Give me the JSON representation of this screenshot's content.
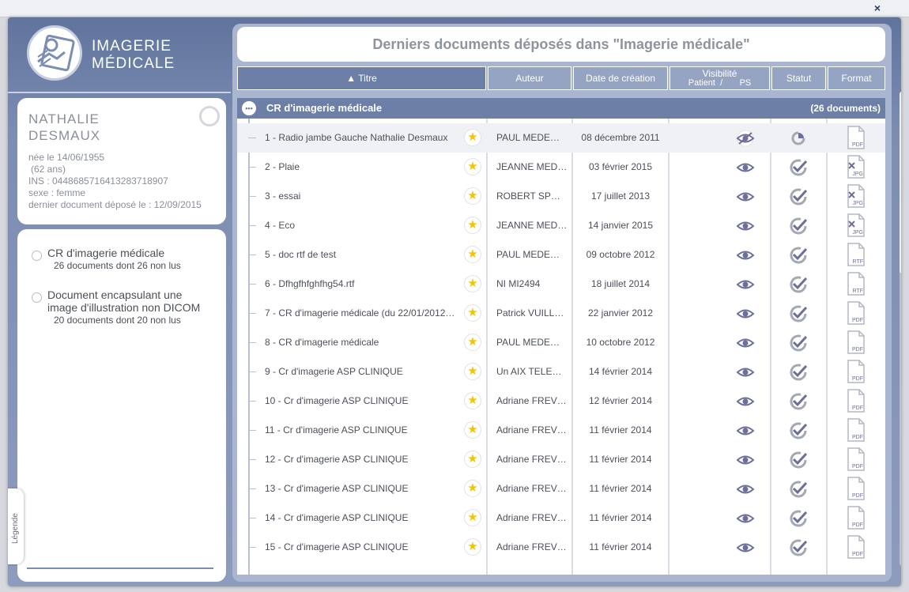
{
  "window": {
    "close_label": "×"
  },
  "logo": {
    "line1": "IMAGERIE",
    "line2": "MÉDICALE"
  },
  "patient": {
    "first_name": "NATHALIE",
    "last_name": "DESMAUX",
    "birth": "née le 14/06/1955",
    "age": "(62 ans)",
    "ins": "INS : 0448685716413283718907",
    "sex": "sexe : femme",
    "last_doc": "dernier document déposé le : 12/09/2015"
  },
  "categories": [
    {
      "label": "CR d'imagerie médicale",
      "sub": "26 documents dont 26 non lus"
    },
    {
      "label": "Document encapsulant une image d'illustration non DICOM",
      "sub": "20 documents dont 20 non lus"
    }
  ],
  "legend_label": "Légende",
  "main": {
    "title": "Derniers documents déposés dans \"Imagerie médicale\"",
    "columns": {
      "title": "▲ Titre",
      "author": "Auteur",
      "date": "Date de création",
      "visibility": "Visibilité",
      "vis_patient": "Patient",
      "vis_sep": "/",
      "vis_ps": "PS",
      "status": "Statut",
      "format": "Format"
    },
    "group": {
      "title": "CR d'imagerie médicale",
      "count": "(26 documents)"
    },
    "rows": [
      {
        "title": "1 - Radio jambe Gauche Nathalie Desmaux",
        "author": "PAUL MEDE…",
        "date": "08 décembre 2011",
        "format": "PDF",
        "hidden": true,
        "pending": true
      },
      {
        "title": "2 - Plaie",
        "author": "JEANNE MED…",
        "date": "03 février 2015",
        "format": "JPG"
      },
      {
        "title": "3 - essai",
        "author": "ROBERT SP…",
        "date": "17 juillet 2013",
        "format": "JPG"
      },
      {
        "title": "4 - Eco",
        "author": "JEANNE MED…",
        "date": "14 janvier 2015",
        "format": "JPG"
      },
      {
        "title": "5 - doc rtf de test",
        "author": "PAUL MEDE…",
        "date": "09 octobre 2012",
        "format": "RTF"
      },
      {
        "title": "6 - Dfhgfhfghfhg54.rtf",
        "author": "NI MI2494",
        "date": "18 juillet 2014",
        "format": "RTF"
      },
      {
        "title": "7 - CR d'imagerie médicale (du 22/01/2012…",
        "author": "Patrick VUILL…",
        "date": "22 janvier 2012",
        "format": "PDF"
      },
      {
        "title": "8 - CR d'imagerie médicale",
        "author": "PAUL MEDE…",
        "date": "10 octobre 2012",
        "format": "PDF"
      },
      {
        "title": "9 - Cr d'imagerie ASP CLINIQUE",
        "author": "Un AIX TELE…",
        "date": "14 février 2014",
        "format": "PDF"
      },
      {
        "title": "10 - Cr d'imagerie ASP CLINIQUE",
        "author": "Adriane FREV…",
        "date": "12 février 2014",
        "format": "PDF"
      },
      {
        "title": "11 - Cr d'imagerie ASP CLINIQUE",
        "author": "Adriane FREV…",
        "date": "11 février 2014",
        "format": "PDF"
      },
      {
        "title": "12 - Cr d'imagerie ASP CLINIQUE",
        "author": "Adriane FREV…",
        "date": "11 février 2014",
        "format": "PDF"
      },
      {
        "title": "13 - Cr d'imagerie ASP CLINIQUE",
        "author": "Adriane FREV…",
        "date": "11 février 2014",
        "format": "PDF"
      },
      {
        "title": "14 - Cr d'imagerie ASP CLINIQUE",
        "author": "Adriane FREV…",
        "date": "11 février 2014",
        "format": "PDF"
      },
      {
        "title": "15 - Cr d'imagerie ASP CLINIQUE",
        "author": "Adriane FREV…",
        "date": "11 février 2014",
        "format": "PDF"
      }
    ]
  },
  "colors": {
    "accent": "#6c7fa7",
    "header_bg": "#96a4c3",
    "star": "#f2c500",
    "icon": "#6c6f9a"
  }
}
